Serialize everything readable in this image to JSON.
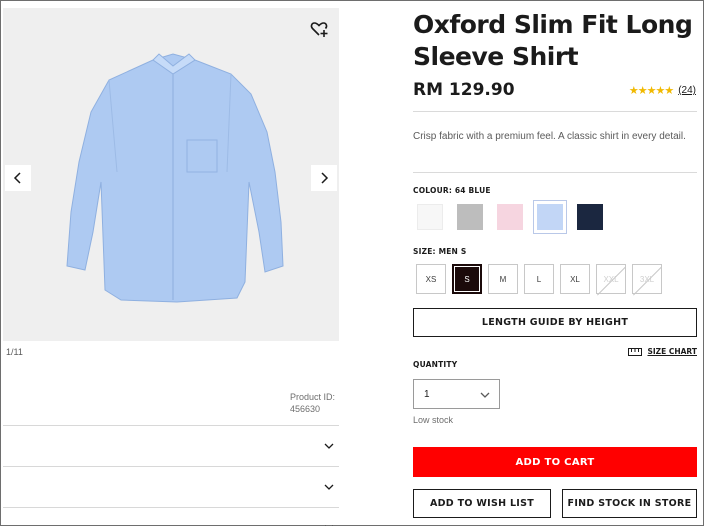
{
  "gallery": {
    "counter": "1/11",
    "product_id_label": "Product ID:",
    "product_id": "456630"
  },
  "product": {
    "title_line1": "Oxford Slim Fit Long",
    "title_line2": "Sleeve Shirt",
    "price": "RM 129.90",
    "rating_stars": "★★★★★",
    "rating_value": 4.5,
    "rating_count": "(24)",
    "description": "Crisp fabric with a premium feel. A classic shirt in every detail."
  },
  "colour": {
    "label": "COLOUR: 64 BLUE",
    "swatches": [
      {
        "name": "white",
        "color": "#f7f7f7",
        "selected": false
      },
      {
        "name": "gray",
        "color": "#bdbdbd",
        "selected": false
      },
      {
        "name": "pink",
        "color": "#f6d5e0",
        "selected": false
      },
      {
        "name": "blue",
        "color": "#c2d6f6",
        "selected": true
      },
      {
        "name": "navy",
        "color": "#1b2740",
        "selected": false
      }
    ]
  },
  "size": {
    "label": "SIZE: MEN S",
    "options": [
      {
        "label": "XS",
        "state": "available"
      },
      {
        "label": "S",
        "state": "selected"
      },
      {
        "label": "M",
        "state": "available"
      },
      {
        "label": "L",
        "state": "available"
      },
      {
        "label": "XL",
        "state": "available"
      },
      {
        "label": "XXL",
        "state": "disabled"
      },
      {
        "label": "3XL",
        "state": "disabled"
      }
    ]
  },
  "buttons": {
    "length_guide": "LENGTH GUIDE BY HEIGHT",
    "size_chart": "SIZE CHART",
    "add_to_cart": "ADD TO CART",
    "wish_list": "ADD TO WISH LIST",
    "find_stock": "FIND STOCK IN STORE"
  },
  "quantity": {
    "label": "QUANTITY",
    "value": "1",
    "stock_status": "Low stock"
  },
  "colors": {
    "accent_red": "#ff0000",
    "text_dark": "#1b1b1b",
    "star_gold": "#f1b900"
  }
}
